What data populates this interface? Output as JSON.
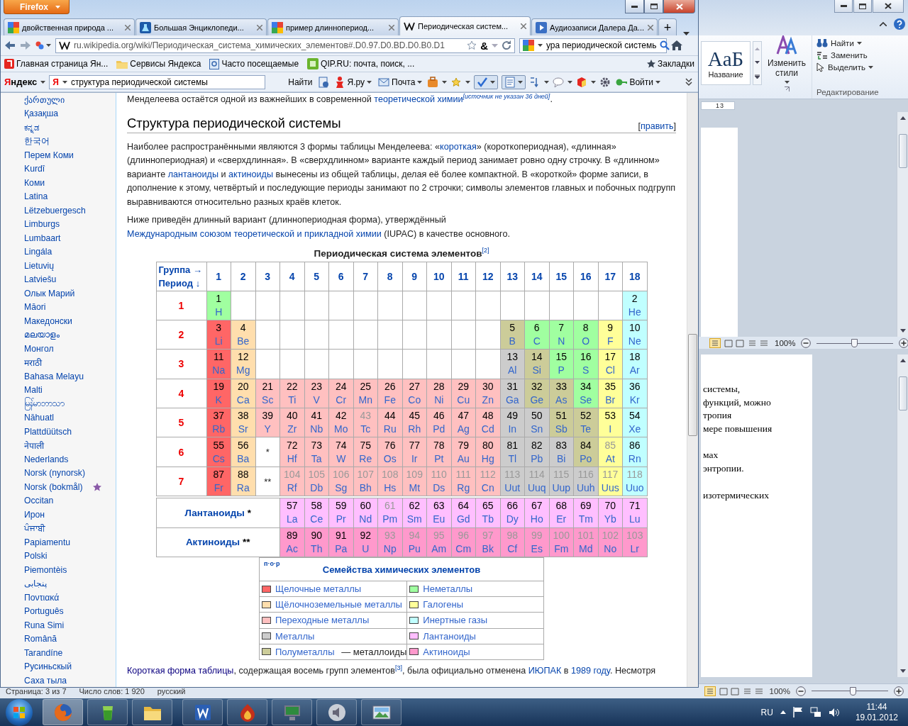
{
  "firefox": {
    "app_button": "Firefox",
    "tabs": [
      {
        "label": "двойственная природа ...",
        "kind": "google",
        "selected": false
      },
      {
        "label": "Большая Энциклопеди...",
        "kind": "flask",
        "selected": false
      },
      {
        "label": "пример длиннопериод...",
        "kind": "google",
        "selected": false
      },
      {
        "label": "Периодическая систем...",
        "kind": "wiki",
        "selected": true
      },
      {
        "label": "Аудиозаписи Далера Да...",
        "kind": "play",
        "selected": false
      }
    ],
    "new_tab": "+",
    "url": "ru.wikipedia.org/wiki/Периодическая_система_химических_элементов#.D0.97.D0.BD.D0.B0.D1",
    "translate_glyph": "&",
    "search_value": "ура периодической системь",
    "bookmarks": [
      {
        "label": "Главная страница Ян...",
        "kind": "yandex"
      },
      {
        "label": "Сервисы Яндекса",
        "kind": "folder"
      },
      {
        "label": "Часто посещаемые",
        "kind": "history"
      },
      {
        "label": "QIP.RU: почта, поиск, ...",
        "kind": "qip"
      }
    ],
    "bookmarks_menu": "Закладки",
    "yandex": {
      "logo": "Яндекс",
      "badge": "Я",
      "query": "структура периодической системы",
      "find": "Найти",
      "yaru": "Я.ру",
      "mail": "Почта",
      "login": "Войти"
    }
  },
  "sidebar": {
    "languages": [
      {
        "label": "ქართული",
        "featured": false
      },
      {
        "label": "Қазақша",
        "featured": false
      },
      {
        "label": "ಕನ್ನಡ",
        "featured": false
      },
      {
        "label": "한국어",
        "featured": false
      },
      {
        "label": "Перем Коми",
        "featured": false
      },
      {
        "label": "Kurdî",
        "featured": false
      },
      {
        "label": "Коми",
        "featured": false
      },
      {
        "label": "Latina",
        "featured": false
      },
      {
        "label": "Lëtzebuergesch",
        "featured": false
      },
      {
        "label": "Limburgs",
        "featured": false
      },
      {
        "label": "Lumbaart",
        "featured": false
      },
      {
        "label": "Lingála",
        "featured": false
      },
      {
        "label": "Lietuvių",
        "featured": false
      },
      {
        "label": "Latviešu",
        "featured": false
      },
      {
        "label": "Олык Марий",
        "featured": false
      },
      {
        "label": "Māori",
        "featured": false
      },
      {
        "label": "Македонски",
        "featured": false
      },
      {
        "label": "മലയാളം",
        "featured": false
      },
      {
        "label": "Монгол",
        "featured": false
      },
      {
        "label": "मराठी",
        "featured": false
      },
      {
        "label": "Bahasa Melayu",
        "featured": false
      },
      {
        "label": "Malti",
        "featured": false
      },
      {
        "label": "မြန်မာဘာသာ",
        "featured": false
      },
      {
        "label": "Nāhuatl",
        "featured": false
      },
      {
        "label": "Plattdüütsch",
        "featured": false
      },
      {
        "label": "नेपाली",
        "featured": false
      },
      {
        "label": "Nederlands",
        "featured": false
      },
      {
        "label": "Norsk (nynorsk)",
        "featured": false
      },
      {
        "label": "Norsk (bokmål)",
        "featured": true
      },
      {
        "label": "Occitan",
        "featured": false
      },
      {
        "label": "Ирон",
        "featured": false
      },
      {
        "label": "ਪੰਜਾਬੀ",
        "featured": false
      },
      {
        "label": "Papiamentu",
        "featured": false
      },
      {
        "label": "Polski",
        "featured": false
      },
      {
        "label": "Piemontèis",
        "featured": false
      },
      {
        "label": "پنجابی",
        "featured": false
      },
      {
        "label": "Ποντιακά",
        "featured": false
      },
      {
        "label": "Português",
        "featured": false
      },
      {
        "label": "Runa Simi",
        "featured": false
      },
      {
        "label": "Română",
        "featured": false
      },
      {
        "label": "Tarandíne",
        "featured": false
      },
      {
        "label": "Русиньскый",
        "featured": false
      },
      {
        "label": "Саха тыла",
        "featured": false
      }
    ]
  },
  "article": {
    "lead": [
      {
        "kind": "text",
        "text": "Менделеева остаётся одной из важнейших в современной "
      },
      {
        "kind": "link",
        "text": "теоретической химии"
      },
      {
        "kind": "note",
        "text": "[источник не указан 36 дней]"
      },
      {
        "kind": "text",
        "text": "."
      }
    ],
    "heading": "Структура периодической системы",
    "edit": {
      "open": "[",
      "label": "править",
      "close": "]"
    },
    "paragraphs": [
      [
        {
          "kind": "text",
          "text": "Наиболее распространёнными являются 3 формы таблицы Менделеева: «"
        },
        {
          "kind": "link",
          "text": "короткая"
        },
        {
          "kind": "text",
          "text": "» (короткопериодная), «длинная» (длиннопериодная) и «сверхдлинная». В «сверхдлинном» варианте каждый период занимает ровно одну строчку. В «длинном» варианте "
        },
        {
          "kind": "link",
          "text": "лантаноиды"
        },
        {
          "kind": "text",
          "text": " и "
        },
        {
          "kind": "link",
          "text": "актиноиды"
        },
        {
          "kind": "text",
          "text": " вынесены из общей таблицы, делая её более компактной. В «короткой» форме записи, в дополнение к этому, четвёртый и последующие периоды занимают по 2 строчки; символы элементов главных и побочных подгрупп выравниваются относительно разных краёв клеток."
        }
      ],
      [
        {
          "kind": "text",
          "text": "Ниже приведён длинный вариант (длиннопериодная форма), утверждённый "
        },
        {
          "kind": "link",
          "text": "Международным союзом теоретической и прикладной химии"
        },
        {
          "kind": "text",
          "text": " (IUPAC) в качестве основного."
        }
      ]
    ],
    "table": {
      "caption": "Периодическая система элементов",
      "caption_ref": "[2]",
      "corner": [
        "Группа →",
        "Период ↓"
      ],
      "groups": [
        "1",
        "2",
        "3",
        "4",
        "5",
        "6",
        "7",
        "8",
        "9",
        "10",
        "11",
        "12",
        "13",
        "14",
        "15",
        "16",
        "17",
        "18"
      ],
      "periods": [
        {
          "label": "1",
          "cells": [
            {
              "kind": "element",
              "number": "1",
              "symbol": "H",
              "color": "#a0ffa0",
              "synthetic": false
            },
            {
              "kind": "blank"
            },
            {
              "kind": "blank"
            },
            {
              "kind": "blank"
            },
            {
              "kind": "blank"
            },
            {
              "kind": "blank"
            },
            {
              "kind": "blank"
            },
            {
              "kind": "blank"
            },
            {
              "kind": "blank"
            },
            {
              "kind": "blank"
            },
            {
              "kind": "blank"
            },
            {
              "kind": "blank"
            },
            {
              "kind": "blank"
            },
            {
              "kind": "blank"
            },
            {
              "kind": "blank"
            },
            {
              "kind": "blank"
            },
            {
              "kind": "blank"
            },
            {
              "kind": "element",
              "number": "2",
              "symbol": "He",
              "color": "#c0ffff",
              "synthetic": false
            }
          ]
        },
        {
          "label": "2",
          "cells": [
            {
              "kind": "element",
              "number": "3",
              "symbol": "Li",
              "color": "#ff6666",
              "synthetic": false
            },
            {
              "kind": "element",
              "number": "4",
              "symbol": "Be",
              "color": "#ffdead",
              "synthetic": false
            },
            {
              "kind": "blank"
            },
            {
              "kind": "blank"
            },
            {
              "kind": "blank"
            },
            {
              "kind": "blank"
            },
            {
              "kind": "blank"
            },
            {
              "kind": "blank"
            },
            {
              "kind": "blank"
            },
            {
              "kind": "blank"
            },
            {
              "kind": "blank"
            },
            {
              "kind": "blank"
            },
            {
              "kind": "element",
              "number": "5",
              "symbol": "B",
              "color": "#cccc99",
              "synthetic": false
            },
            {
              "kind": "element",
              "number": "6",
              "symbol": "C",
              "color": "#a0ffa0",
              "synthetic": false
            },
            {
              "kind": "element",
              "number": "7",
              "symbol": "N",
              "color": "#a0ffa0",
              "synthetic": false
            },
            {
              "kind": "element",
              "number": "8",
              "symbol": "O",
              "color": "#a0ffa0",
              "synthetic": false
            },
            {
              "kind": "element",
              "number": "9",
              "symbol": "F",
              "color": "#ffff99",
              "synthetic": false
            },
            {
              "kind": "element",
              "number": "10",
              "symbol": "Ne",
              "color": "#c0ffff",
              "synthetic": false
            }
          ]
        },
        {
          "label": "3",
          "cells": [
            {
              "kind": "element",
              "number": "11",
              "symbol": "Na",
              "color": "#ff6666",
              "synthetic": false
            },
            {
              "kind": "element",
              "number": "12",
              "symbol": "Mg",
              "color": "#ffdead",
              "synthetic": false
            },
            {
              "kind": "blank"
            },
            {
              "kind": "blank"
            },
            {
              "kind": "blank"
            },
            {
              "kind": "blank"
            },
            {
              "kind": "blank"
            },
            {
              "kind": "blank"
            },
            {
              "kind": "blank"
            },
            {
              "kind": "blank"
            },
            {
              "kind": "blank"
            },
            {
              "kind": "blank"
            },
            {
              "kind": "element",
              "number": "13",
              "symbol": "Al",
              "color": "#cccccc",
              "synthetic": false
            },
            {
              "kind": "element",
              "number": "14",
              "symbol": "Si",
              "color": "#cccc99",
              "synthetic": false
            },
            {
              "kind": "element",
              "number": "15",
              "symbol": "P",
              "color": "#a0ffa0",
              "synthetic": false
            },
            {
              "kind": "element",
              "number": "16",
              "symbol": "S",
              "color": "#a0ffa0",
              "synthetic": false
            },
            {
              "kind": "element",
              "number": "17",
              "symbol": "Cl",
              "color": "#ffff99",
              "synthetic": false
            },
            {
              "kind": "element",
              "number": "18",
              "symbol": "Ar",
              "color": "#c0ffff",
              "synthetic": false
            }
          ]
        },
        {
          "label": "4",
          "cells": [
            {
              "kind": "element",
              "number": "19",
              "symbol": "K",
              "color": "#ff6666",
              "synthetic": false
            },
            {
              "kind": "element",
              "number": "20",
              "symbol": "Ca",
              "color": "#ffdead",
              "synthetic": false
            },
            {
              "kind": "element",
              "number": "21",
              "symbol": "Sc",
              "color": "#ffc0c0",
              "synthetic": false
            },
            {
              "kind": "element",
              "number": "22",
              "symbol": "Ti",
              "color": "#ffc0c0",
              "synthetic": false
            },
            {
              "kind": "element",
              "number": "23",
              "symbol": "V",
              "color": "#ffc0c0",
              "synthetic": false
            },
            {
              "kind": "element",
              "number": "24",
              "symbol": "Cr",
              "color": "#ffc0c0",
              "synthetic": false
            },
            {
              "kind": "element",
              "number": "25",
              "symbol": "Mn",
              "color": "#ffc0c0",
              "synthetic": false
            },
            {
              "kind": "element",
              "number": "26",
              "symbol": "Fe",
              "color": "#ffc0c0",
              "synthetic": false
            },
            {
              "kind": "element",
              "number": "27",
              "symbol": "Co",
              "color": "#ffc0c0",
              "synthetic": false
            },
            {
              "kind": "element",
              "number": "28",
              "symbol": "Ni",
              "color": "#ffc0c0",
              "synthetic": false
            },
            {
              "kind": "element",
              "number": "29",
              "symbol": "Cu",
              "color": "#ffc0c0",
              "synthetic": false
            },
            {
              "kind": "element",
              "number": "30",
              "symbol": "Zn",
              "color": "#ffc0c0",
              "synthetic": false
            },
            {
              "kind": "element",
              "number": "31",
              "symbol": "Ga",
              "color": "#cccccc",
              "synthetic": false
            },
            {
              "kind": "element",
              "number": "32",
              "symbol": "Ge",
              "color": "#cccc99",
              "synthetic": false
            },
            {
              "kind": "element",
              "number": "33",
              "symbol": "As",
              "color": "#cccc99",
              "synthetic": false
            },
            {
              "kind": "element",
              "number": "34",
              "symbol": "Se",
              "color": "#a0ffa0",
              "synthetic": false
            },
            {
              "kind": "element",
              "number": "35",
              "symbol": "Br",
              "color": "#ffff99",
              "synthetic": false
            },
            {
              "kind": "element",
              "number": "36",
              "symbol": "Kr",
              "color": "#c0ffff",
              "synthetic": false
            }
          ]
        },
        {
          "label": "5",
          "cells": [
            {
              "kind": "element",
              "number": "37",
              "symbol": "Rb",
              "color": "#ff6666",
              "synthetic": false
            },
            {
              "kind": "element",
              "number": "38",
              "symbol": "Sr",
              "color": "#ffdead",
              "synthetic": false
            },
            {
              "kind": "element",
              "number": "39",
              "symbol": "Y",
              "color": "#ffc0c0",
              "synthetic": false
            },
            {
              "kind": "element",
              "number": "40",
              "symbol": "Zr",
              "color": "#ffc0c0",
              "synthetic": false
            },
            {
              "kind": "element",
              "number": "41",
              "symbol": "Nb",
              "color": "#ffc0c0",
              "synthetic": false
            },
            {
              "kind": "element",
              "number": "42",
              "symbol": "Mo",
              "color": "#ffc0c0",
              "synthetic": false
            },
            {
              "kind": "element",
              "number": "43",
              "symbol": "Tc",
              "color": "#ffc0c0",
              "synthetic": true
            },
            {
              "kind": "element",
              "number": "44",
              "symbol": "Ru",
              "color": "#ffc0c0",
              "synthetic": false
            },
            {
              "kind": "element",
              "number": "45",
              "symbol": "Rh",
              "color": "#ffc0c0",
              "synthetic": false
            },
            {
              "kind": "element",
              "number": "46",
              "symbol": "Pd",
              "color": "#ffc0c0",
              "synthetic": false
            },
            {
              "kind": "element",
              "number": "47",
              "symbol": "Ag",
              "color": "#ffc0c0",
              "synthetic": false
            },
            {
              "kind": "element",
              "number": "48",
              "symbol": "Cd",
              "color": "#ffc0c0",
              "synthetic": false
            },
            {
              "kind": "element",
              "number": "49",
              "symbol": "In",
              "color": "#cccccc",
              "synthetic": false
            },
            {
              "kind": "element",
              "number": "50",
              "symbol": "Sn",
              "color": "#cccccc",
              "synthetic": false
            },
            {
              "kind": "element",
              "number": "51",
              "symbol": "Sb",
              "color": "#cccc99",
              "synthetic": false
            },
            {
              "kind": "element",
              "number": "52",
              "symbol": "Te",
              "color": "#cccc99",
              "synthetic": false
            },
            {
              "kind": "element",
              "number": "53",
              "symbol": "I",
              "color": "#ffff99",
              "synthetic": false
            },
            {
              "kind": "element",
              "number": "54",
              "symbol": "Xe",
              "color": "#c0ffff",
              "synthetic": false
            }
          ]
        },
        {
          "label": "6",
          "cells": [
            {
              "kind": "element",
              "number": "55",
              "symbol": "Cs",
              "color": "#ff6666",
              "synthetic": false
            },
            {
              "kind": "element",
              "number": "56",
              "symbol": "Ba",
              "color": "#ffdead",
              "synthetic": false
            },
            {
              "kind": "ref",
              "text": "*"
            },
            {
              "kind": "element",
              "number": "72",
              "symbol": "Hf",
              "color": "#ffc0c0",
              "synthetic": false
            },
            {
              "kind": "element",
              "number": "73",
              "symbol": "Ta",
              "color": "#ffc0c0",
              "synthetic": false
            },
            {
              "kind": "element",
              "number": "74",
              "symbol": "W",
              "color": "#ffc0c0",
              "synthetic": false
            },
            {
              "kind": "element",
              "number": "75",
              "symbol": "Re",
              "color": "#ffc0c0",
              "synthetic": false
            },
            {
              "kind": "element",
              "number": "76",
              "symbol": "Os",
              "color": "#ffc0c0",
              "synthetic": false
            },
            {
              "kind": "element",
              "number": "77",
              "symbol": "Ir",
              "color": "#ffc0c0",
              "synthetic": false
            },
            {
              "kind": "element",
              "number": "78",
              "symbol": "Pt",
              "color": "#ffc0c0",
              "synthetic": false
            },
            {
              "kind": "element",
              "number": "79",
              "symbol": "Au",
              "color": "#ffc0c0",
              "synthetic": false
            },
            {
              "kind": "element",
              "number": "80",
              "symbol": "Hg",
              "color": "#ffc0c0",
              "synthetic": false
            },
            {
              "kind": "element",
              "number": "81",
              "symbol": "Tl",
              "color": "#cccccc",
              "synthetic": false
            },
            {
              "kind": "element",
              "number": "82",
              "symbol": "Pb",
              "color": "#cccccc",
              "synthetic": false
            },
            {
              "kind": "element",
              "number": "83",
              "symbol": "Bi",
              "color": "#cccccc",
              "synthetic": false
            },
            {
              "kind": "element",
              "number": "84",
              "symbol": "Po",
              "color": "#cccc99",
              "synthetic": false
            },
            {
              "kind": "element",
              "number": "85",
              "symbol": "At",
              "color": "#ffff99",
              "synthetic": true
            },
            {
              "kind": "element",
              "number": "86",
              "symbol": "Rn",
              "color": "#c0ffff",
              "synthetic": false
            }
          ]
        },
        {
          "label": "7",
          "cells": [
            {
              "kind": "element",
              "number": "87",
              "symbol": "Fr",
              "color": "#ff6666",
              "synthetic": false
            },
            {
              "kind": "element",
              "number": "88",
              "symbol": "Ra",
              "color": "#ffdead",
              "synthetic": false
            },
            {
              "kind": "ref",
              "text": "**"
            },
            {
              "kind": "element",
              "number": "104",
              "symbol": "Rf",
              "color": "#ffc0c0",
              "synthetic": true
            },
            {
              "kind": "element",
              "number": "105",
              "symbol": "Db",
              "color": "#ffc0c0",
              "synthetic": true
            },
            {
              "kind": "element",
              "number": "106",
              "symbol": "Sg",
              "color": "#ffc0c0",
              "synthetic": true
            },
            {
              "kind": "element",
              "number": "107",
              "symbol": "Bh",
              "color": "#ffc0c0",
              "synthetic": true
            },
            {
              "kind": "element",
              "number": "108",
              "symbol": "Hs",
              "color": "#ffc0c0",
              "synthetic": true
            },
            {
              "kind": "element",
              "number": "109",
              "symbol": "Mt",
              "color": "#ffc0c0",
              "synthetic": true
            },
            {
              "kind": "element",
              "number": "110",
              "symbol": "Ds",
              "color": "#ffc0c0",
              "synthetic": true
            },
            {
              "kind": "element",
              "number": "111",
              "symbol": "Rg",
              "color": "#ffc0c0",
              "synthetic": true
            },
            {
              "kind": "element",
              "number": "112",
              "symbol": "Cn",
              "color": "#ffc0c0",
              "synthetic": true
            },
            {
              "kind": "element",
              "number": "113",
              "symbol": "Uut",
              "color": "#cccccc",
              "synthetic": true
            },
            {
              "kind": "element",
              "number": "114",
              "symbol": "Uuq",
              "color": "#cccccc",
              "synthetic": true
            },
            {
              "kind": "element",
              "number": "115",
              "symbol": "Uup",
              "color": "#cccccc",
              "synthetic": true
            },
            {
              "kind": "element",
              "number": "116",
              "symbol": "Uuh",
              "color": "#cccccc",
              "synthetic": true
            },
            {
              "kind": "element",
              "number": "117",
              "symbol": "Uus",
              "color": "#ffff99",
              "synthetic": true
            },
            {
              "kind": "element",
              "number": "118",
              "symbol": "Uuo",
              "color": "#c0ffff",
              "synthetic": true
            }
          ]
        }
      ],
      "series": [
        {
          "label": "Лантаноиды",
          "mark": "*",
          "cells": [
            {
              "kind": "element",
              "number": "57",
              "symbol": "La",
              "color": "#ffbfff",
              "synthetic": false
            },
            {
              "kind": "element",
              "number": "58",
              "symbol": "Ce",
              "color": "#ffbfff",
              "synthetic": false
            },
            {
              "kind": "element",
              "number": "59",
              "symbol": "Pr",
              "color": "#ffbfff",
              "synthetic": false
            },
            {
              "kind": "element",
              "number": "60",
              "symbol": "Nd",
              "color": "#ffbfff",
              "synthetic": false
            },
            {
              "kind": "element",
              "number": "61",
              "symbol": "Pm",
              "color": "#ffbfff",
              "synthetic": true
            },
            {
              "kind": "element",
              "number": "62",
              "symbol": "Sm",
              "color": "#ffbfff",
              "synthetic": false
            },
            {
              "kind": "element",
              "number": "63",
              "symbol": "Eu",
              "color": "#ffbfff",
              "synthetic": false
            },
            {
              "kind": "element",
              "number": "64",
              "symbol": "Gd",
              "color": "#ffbfff",
              "synthetic": false
            },
            {
              "kind": "element",
              "number": "65",
              "symbol": "Tb",
              "color": "#ffbfff",
              "synthetic": false
            },
            {
              "kind": "element",
              "number": "66",
              "symbol": "Dy",
              "color": "#ffbfff",
              "synthetic": false
            },
            {
              "kind": "element",
              "number": "67",
              "symbol": "Ho",
              "color": "#ffbfff",
              "synthetic": false
            },
            {
              "kind": "element",
              "number": "68",
              "symbol": "Er",
              "color": "#ffbfff",
              "synthetic": false
            },
            {
              "kind": "element",
              "number": "69",
              "symbol": "Tm",
              "color": "#ffbfff",
              "synthetic": false
            },
            {
              "kind": "element",
              "number": "70",
              "symbol": "Yb",
              "color": "#ffbfff",
              "synthetic": false
            },
            {
              "kind": "element",
              "number": "71",
              "symbol": "Lu",
              "color": "#ffbfff",
              "synthetic": false
            }
          ]
        },
        {
          "label": "Актиноиды",
          "mark": "**",
          "cells": [
            {
              "kind": "element",
              "number": "89",
              "symbol": "Ac",
              "color": "#ff99cc",
              "synthetic": false
            },
            {
              "kind": "element",
              "number": "90",
              "symbol": "Th",
              "color": "#ff99cc",
              "synthetic": false
            },
            {
              "kind": "element",
              "number": "91",
              "symbol": "Pa",
              "color": "#ff99cc",
              "synthetic": false
            },
            {
              "kind": "element",
              "number": "92",
              "symbol": "U",
              "color": "#ff99cc",
              "synthetic": false
            },
            {
              "kind": "element",
              "number": "93",
              "symbol": "Np",
              "color": "#ff99cc",
              "synthetic": true
            },
            {
              "kind": "element",
              "number": "94",
              "symbol": "Pu",
              "color": "#ff99cc",
              "synthetic": true
            },
            {
              "kind": "element",
              "number": "95",
              "symbol": "Am",
              "color": "#ff99cc",
              "synthetic": true
            },
            {
              "kind": "element",
              "number": "96",
              "symbol": "Cm",
              "color": "#ff99cc",
              "synthetic": true
            },
            {
              "kind": "element",
              "number": "97",
              "symbol": "Bk",
              "color": "#ff99cc",
              "synthetic": true
            },
            {
              "kind": "element",
              "number": "98",
              "symbol": "Cf",
              "color": "#ff99cc",
              "synthetic": true
            },
            {
              "kind": "element",
              "number": "99",
              "symbol": "Es",
              "color": "#ff99cc",
              "synthetic": true
            },
            {
              "kind": "element",
              "number": "100",
              "symbol": "Fm",
              "color": "#ff99cc",
              "synthetic": true
            },
            {
              "kind": "element",
              "number": "101",
              "symbol": "Md",
              "color": "#ff99cc",
              "synthetic": true
            },
            {
              "kind": "element",
              "number": "102",
              "symbol": "No",
              "color": "#ff99cc",
              "synthetic": true
            },
            {
              "kind": "element",
              "number": "103",
              "symbol": "Lr",
              "color": "#ff99cc",
              "synthetic": true
            }
          ]
        }
      ]
    },
    "legend": {
      "nav": "п·о·р",
      "title": "Семейства химических элементов",
      "families": [
        {
          "label": "Щелочные металлы",
          "color": "#ff6666"
        },
        {
          "label": "Неметаллы",
          "color": "#a0ffa0"
        },
        {
          "label": "Щёлочноземельные металлы",
          "color": "#ffdead"
        },
        {
          "label": "Галогены",
          "color": "#ffff99"
        },
        {
          "label": "Переходные металлы",
          "color": "#ffc0c0"
        },
        {
          "label": "Инертные газы",
          "color": "#c0ffff"
        },
        {
          "label": "Металлы",
          "color": "#cccccc"
        },
        {
          "label": "Лантаноиды",
          "color": "#ffbfff"
        },
        {
          "label": "Полуметаллы",
          "suffix": " — металлоиды",
          "color": "#cccc99"
        },
        {
          "label": "Актиноиды",
          "color": "#ff99cc"
        }
      ]
    },
    "closing": [
      {
        "kind": "visited",
        "text": "Короткая форма таблицы"
      },
      {
        "kind": "text",
        "text": ", содержащая восемь групп элементов"
      },
      {
        "kind": "ref",
        "text": "[3]"
      },
      {
        "kind": "text",
        "text": ", была официально отменена "
      },
      {
        "kind": "link",
        "text": "ИЮПАК"
      },
      {
        "kind": "text",
        "text": " в "
      },
      {
        "kind": "link",
        "text": "1989 году"
      },
      {
        "kind": "text",
        "text": ". Несмотря"
      }
    ]
  },
  "word": {
    "style_preview": "AaБ",
    "style_name": "Название",
    "change_styles": "Изменить стили",
    "find": "Найти",
    "replace": "Заменить",
    "select": "Выделить",
    "editing_group": "Редактирование",
    "ruler_mark": "13",
    "upper_zoom": {
      "label": "100%",
      "level": 0.5
    },
    "doc_paragraphs": [
      [
        "системы,",
        "функций, можно",
        "тропия",
        "мере повышения"
      ],
      [
        "мах",
        "энтропии."
      ],
      [
        "изотермических"
      ]
    ],
    "status": [
      "Страница: 3 из 7",
      "Число слов: 1 920",
      "русский"
    ],
    "lower_zoom": {
      "label": "100%",
      "level": 0.55
    }
  },
  "taskbar": {
    "apps": [
      {
        "kind": "firefox",
        "active": true
      },
      {
        "kind": "cup",
        "active": false
      },
      {
        "kind": "folder",
        "active": false
      },
      {
        "kind": "word",
        "active": false
      },
      {
        "kind": "flame",
        "active": false
      },
      {
        "kind": "monitor",
        "active": false
      },
      {
        "kind": "speaker",
        "active": false
      },
      {
        "kind": "picture",
        "active": false
      }
    ],
    "language": "RU",
    "time": "11:44",
    "date": "19.01.2012"
  }
}
